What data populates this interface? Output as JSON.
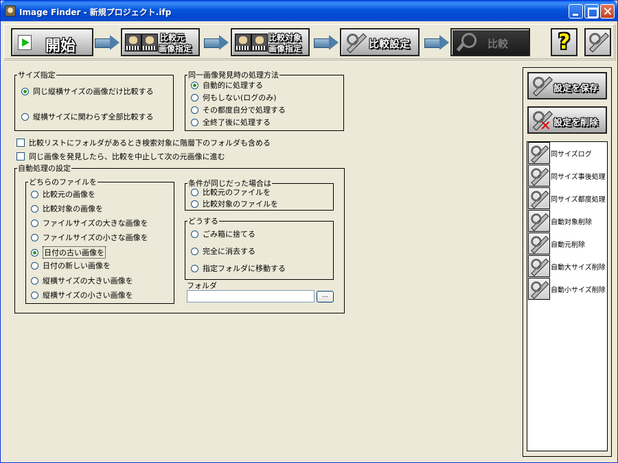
{
  "window": {
    "title": "Image Finder - 新規プロジェクト.ifp"
  },
  "toolbar": {
    "start_label": "開始",
    "source_label_line1": "比較元",
    "source_label_line2": "画像指定",
    "target_label_line1": "比較対象",
    "target_label_line2": "画像指定",
    "settings_label": "比較設定",
    "compare_label": "比較",
    "help_label": "?"
  },
  "size_group": {
    "legend": "サイズ指定",
    "options": [
      "同じ縦横サイズの画像だけ比較する",
      "縦横サイズに関わらず全部比較する"
    ],
    "selected": 0
  },
  "same_image_group": {
    "legend": "同一画像発見時の処理方法",
    "options": [
      "自動的に処理する",
      "何もしない(ログのみ)",
      "その都度自分で処理する",
      "全終了後に処理する"
    ],
    "selected": 0
  },
  "checks": {
    "include_subfolders": "比較リストにフォルダがあるとき検索対象に階層下のフォルダも含める",
    "stop_on_found": "同じ画像を発見したら、比較を中止して次の元画像に進む"
  },
  "auto_group": {
    "legend": "自動処理の設定",
    "which_file": {
      "legend": "どちらのファイルを",
      "options": [
        "比較元の画像を",
        "比較対象の画像を",
        "ファイルサイズの大きな画像を",
        "ファイルサイズの小さな画像を",
        "日付の古い画像を",
        "日付の新しい画像を",
        "縦横サイズの大きい画像を",
        "縦横サイズの小さい画像を"
      ],
      "selected": 4
    },
    "if_same": {
      "legend": "条件が同じだった場合は",
      "options": [
        "比較元のファイルを",
        "比較対象のファイルを"
      ]
    },
    "action": {
      "legend": "どうする",
      "options": [
        "ごみ箱に捨てる",
        "完全に消去する",
        "指定フォルダに移動する"
      ]
    },
    "folder_label": "フォルダ",
    "folder_value": "",
    "browse_label": "..."
  },
  "right_panel": {
    "save_label": "設定を保存",
    "delete_label": "設定を削除",
    "presets": [
      "同サイズログ",
      "同サイズ事後処理",
      "同サイズ都度処理",
      "自動対象削除",
      "自動元削除",
      "自動大サイズ削除",
      "自動小サイズ削除"
    ]
  }
}
